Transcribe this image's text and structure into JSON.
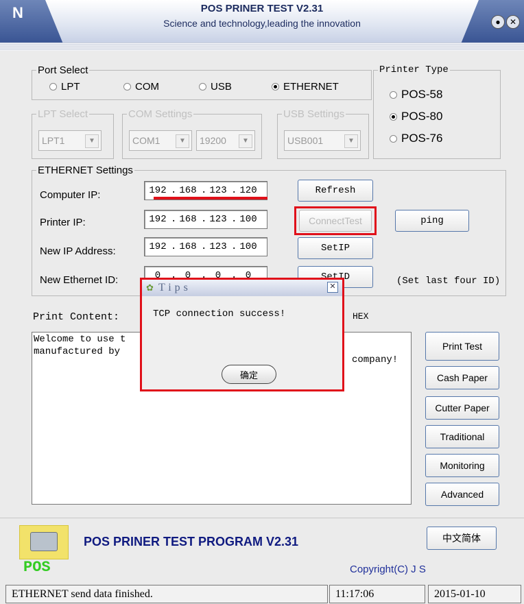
{
  "window": {
    "title": "POS PRINER TEST V2.31",
    "subtitle": "Science and technology,leading the innovation",
    "logo_glyph": "N",
    "minimize_glyph": "●",
    "close_glyph": "✕"
  },
  "port_select": {
    "legend": "Port Select",
    "options": [
      "LPT",
      "COM",
      "USB",
      "ETHERNET"
    ],
    "selected": "ETHERNET"
  },
  "printer_type": {
    "legend": "Printer Type",
    "options": [
      "POS-58",
      "POS-80",
      "POS-76"
    ],
    "selected": "POS-80"
  },
  "lpt_select": {
    "legend": "LPT Select",
    "value": "LPT1"
  },
  "com_settings": {
    "legend": "COM Settings",
    "port": "COM1",
    "baud": "19200"
  },
  "usb_settings": {
    "legend": "USB Settings",
    "value": "USB001"
  },
  "ethernet": {
    "legend": "ETHERNET Settings",
    "computer_ip_label": "Computer IP:",
    "computer_ip": [
      "192",
      "168",
      "123",
      "120"
    ],
    "printer_ip_label": "Printer IP:",
    "printer_ip": [
      "192",
      "168",
      "123",
      "100"
    ],
    "new_ip_label": "New IP Address:",
    "new_ip": [
      "192",
      "168",
      "123",
      "100"
    ],
    "new_id_label": "New Ethernet ID:",
    "new_id": [
      "0",
      "0",
      "0",
      "0"
    ],
    "refresh_label": "Refresh",
    "connect_test_label": "ConnectTest",
    "ping_label": "ping",
    "setip_label": "SetIP",
    "setid_label": "SetID",
    "setid_hint": "(Set last four ID)"
  },
  "print_content": {
    "label": "Print Content:",
    "hex_label": "HEX",
    "line1_visible": "Welcome to use t",
    "line2_left": "manufactured by",
    "line2_right": "company!"
  },
  "side_buttons": [
    "Print Test",
    "Cash Paper",
    "Cutter Paper",
    "Traditional",
    "Monitoring",
    "Advanced"
  ],
  "language_button": "中文简体",
  "dialog": {
    "title": "Tips",
    "message": "TCP connection success!",
    "ok_label": "确定",
    "close_glyph": "✕",
    "icon_glyph": "✿"
  },
  "footer": {
    "program_title": "POS PRINER TEST PROGRAM V2.31",
    "copyright": "Copyright(C) J S",
    "logo_text": "POS"
  },
  "status_bar": {
    "message": "ETHERNET send data finished.",
    "time": "11:17:06",
    "date": "2015-01-10"
  },
  "colors": {
    "highlight": "#e0101a",
    "title_text": "#0f1a80",
    "logo_green": "#33cc22"
  }
}
